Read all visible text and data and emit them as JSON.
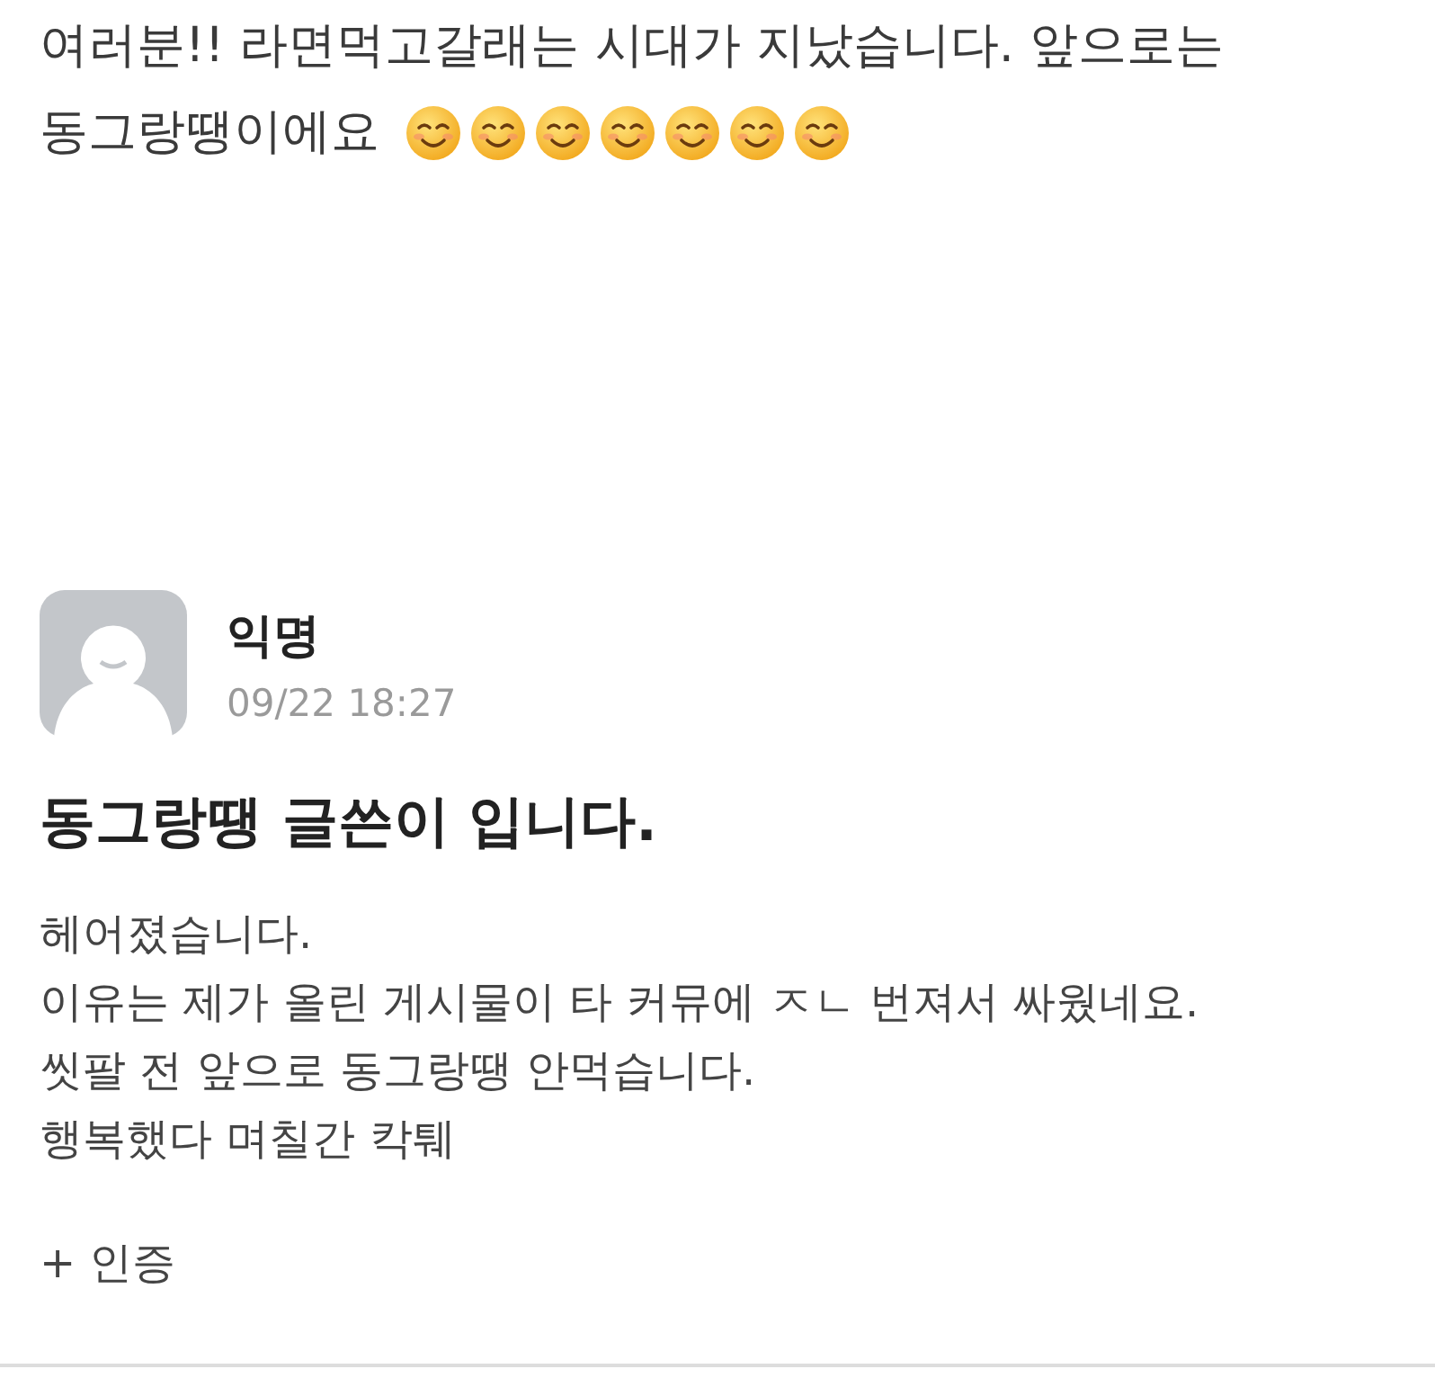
{
  "caption": {
    "lines": [
      "여러분!! 라면먹고갈래는 시대가 지났습니다. 앞으로는",
      "동그랑땡이에요"
    ]
  },
  "post": {
    "author": "익명",
    "time": "09/22 18:27",
    "title": "동그랑땡 글쓴이 입니다.",
    "body": [
      "헤어졌습니다.",
      "이유는 제가 올린 게시물이 타 커뮤에 ㅈㄴ 번져서 싸웠네요.",
      "씻팔 전 앞으로 동그랑땡 안먹습니다.",
      "행복했다 며칠간 칵퉤"
    ],
    "attachment_label": "+ 인증"
  }
}
